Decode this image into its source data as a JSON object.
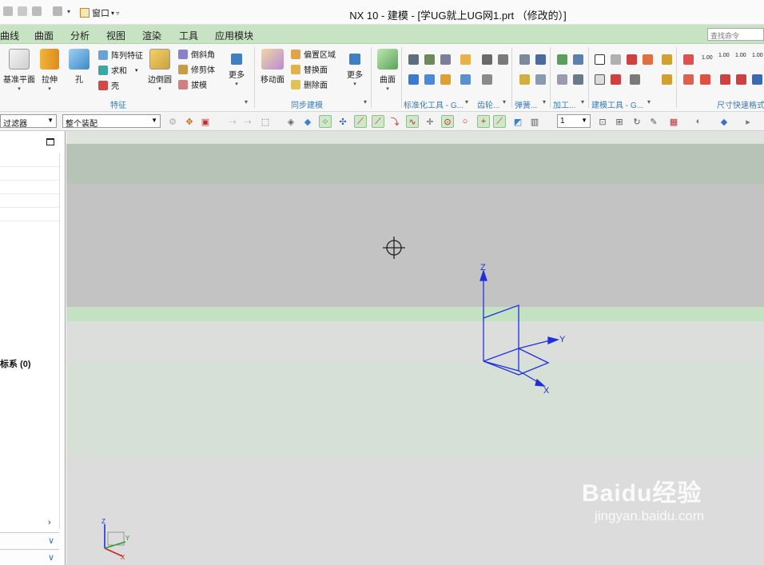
{
  "title": "NX 10 - 建模 - [学UG就上UG网1.prt （修改的）]",
  "window_menu": "窗口",
  "menus": [
    "曲线",
    "曲面",
    "分析",
    "视图",
    "渲染",
    "工具",
    "应用模块"
  ],
  "search_placeholder": "查找命令",
  "ribbon": {
    "datum_plane": "基准平面",
    "extrude": "拉伸",
    "hole": "孔",
    "pattern_feature": "阵列特征",
    "unite": "求和",
    "shell": "壳",
    "edge_blend": "边倒圆",
    "chamfer": "倒斜角",
    "trim_body": "修剪体",
    "draft": "拔模",
    "more_1": "更多",
    "move_face": "移动面",
    "offset_region": "偏置区域",
    "replace_face": "替换面",
    "delete_face": "删除面",
    "more_2": "更多",
    "surface": "曲面",
    "groups": {
      "feature": "特征",
      "sync_modeling": "同步建模",
      "std_tools": "标准化工具 - G...",
      "gear": "齿轮...",
      "spring": "弹簧...",
      "machining": "加工...",
      "modeling_tools": "建模工具 - G...",
      "dim_format": "尺寸快速格式"
    },
    "dim_values": [
      "1.00",
      "1.00",
      "1.00",
      "1.00"
    ]
  },
  "selection_bar": {
    "filter": "过滤器",
    "assembly_scope": "整个装配",
    "count": "1"
  },
  "navigator": {
    "coord_label": "标系 (0)"
  },
  "triad": {
    "x": "X",
    "y": "Y",
    "z": "Z"
  },
  "watermark": {
    "main": "Baidu经验",
    "sub": "jingyan.baidu.com"
  },
  "colors": {
    "menubar": "#c8e2c4",
    "triad": "#1f2fe0",
    "group_title": "#3a7ab8"
  }
}
